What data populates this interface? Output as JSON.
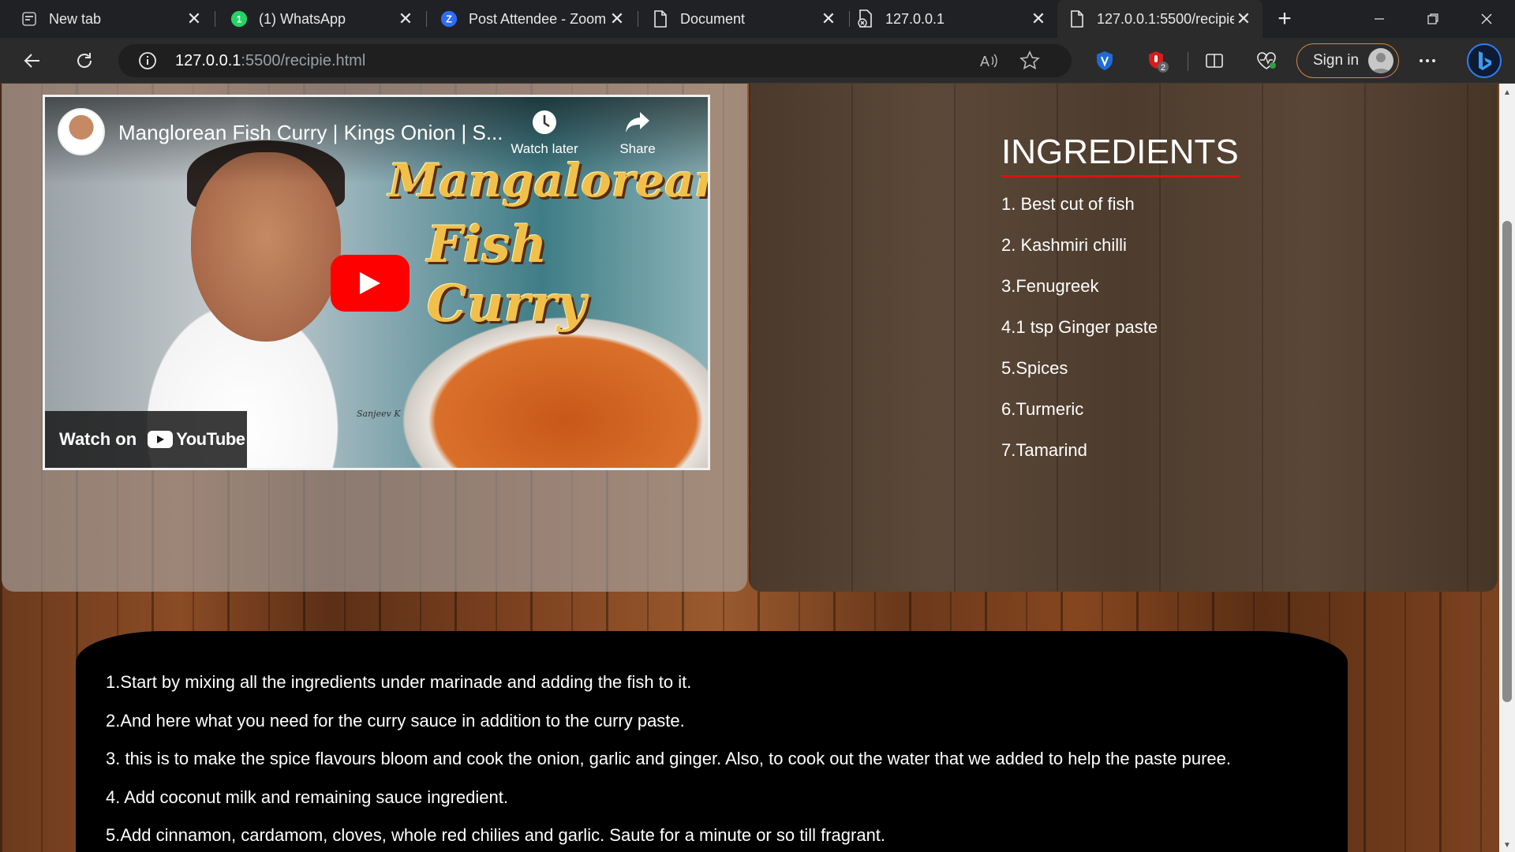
{
  "browser": {
    "tabs": [
      {
        "title": "New tab",
        "icon": "new-tab-icon"
      },
      {
        "title": "(1) WhatsApp",
        "icon": "whatsapp-icon",
        "badge": "1"
      },
      {
        "title": "Post Attendee - Zoom",
        "icon": "zoom-icon"
      },
      {
        "title": "Document",
        "icon": "document-icon"
      },
      {
        "title": "127.0.0.1",
        "icon": "document-error-icon"
      },
      {
        "title": "127.0.0.1:5500/recipie.html",
        "icon": "document-icon",
        "active": true
      }
    ],
    "url_host": "127.0.0.1",
    "url_rest": ":5500/recipie.html",
    "extension_badge": "2",
    "sign_in_label": "Sign in",
    "colors": {
      "tab_strip": "#202124",
      "toolbar": "#2b2b2b",
      "signin_border": "#d8893a"
    }
  },
  "video": {
    "title": "Manglorean Fish Curry | Kings Onion | S...",
    "watch_later_label": "Watch later",
    "share_label": "Share",
    "overlay_line1": "Mangalorean",
    "overlay_line2": "Fish Curry",
    "watch_on_label": "Watch on",
    "youtube_label": "YouTube",
    "signature": "Sanjeev K"
  },
  "ingredients": {
    "title": "INGREDIENTS",
    "items": [
      "1. Best cut of fish",
      "2. Kashmiri chilli",
      "3.Fenugreek",
      "4.1 tsp Ginger paste",
      "5.Spices",
      "6.Turmeric",
      "7.Tamarind"
    ],
    "underline_color": "#e01010"
  },
  "steps": [
    "1.Start by mixing all the ingredients under marinade and adding the fish to it.",
    "2.And here what you need for the curry sauce in addition to the curry paste.",
    "3. this is to make the spice flavours bloom and cook the onion, garlic and ginger. Also, to cook out the water that we added to help the paste puree.",
    "4. Add coconut milk and remaining sauce ingredient.",
    "5.Add cinnamon, cardamom, cloves, whole red chilies and garlic. Saute for a minute or so till fragrant."
  ]
}
